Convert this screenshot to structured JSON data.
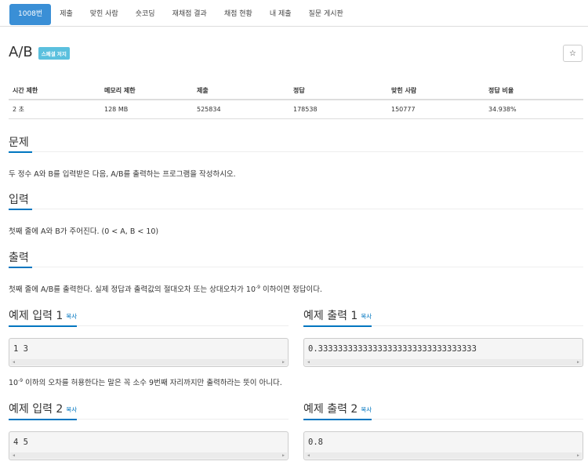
{
  "nav": {
    "items": [
      {
        "label": "1008번",
        "active": true
      },
      {
        "label": "제출"
      },
      {
        "label": "맞힌 사람"
      },
      {
        "label": "숏코딩"
      },
      {
        "label": "재채점 결과"
      },
      {
        "label": "채점 현황"
      },
      {
        "label": "내 제출"
      },
      {
        "label": "질문 게시판"
      }
    ]
  },
  "problem": {
    "title": "A/B",
    "badge": "스페셜 저지",
    "star_icon": "star-icon",
    "star_glyph": "☆"
  },
  "info": {
    "headers": [
      "시간 제한",
      "메모리 제한",
      "제출",
      "정답",
      "맞힌 사람",
      "정답 비율"
    ],
    "values": [
      "2 초",
      "128 MB",
      "525834",
      "178538",
      "150777",
      "34.938%"
    ]
  },
  "sections": {
    "problem_heading": "문제",
    "problem_text": "두 정수 A와 B를 입력받은 다음, A/B를 출력하는 프로그램을 작성하시오.",
    "input_heading": "입력",
    "input_text": "첫째 줄에 A와 B가 주어진다. (0 < A, B < 10)",
    "output_heading": "출력",
    "output_text_1": "첫째 줄에 A/B를 출력한다. 실제 정답과 출력값의 절대오차 또는 상대오차가 10",
    "output_sup": "-9",
    "output_text_2": " 이하이면 정답이다."
  },
  "examples": {
    "copy_label": "복사",
    "input1_heading": "예제 입력 1",
    "input1": "1 3",
    "output1_heading": "예제 출력 1",
    "output1": "0.33333333333333333333333333333333",
    "note_1": "10",
    "note_sup": "-9",
    "note_2": " 이하의 오차를 허용한다는 말은 꼭 소수 9번째 자리까지만 출력하라는 뜻이 아니다.",
    "input2_heading": "예제 입력 2",
    "input2": "4 5",
    "output2_heading": "예제 출력 2",
    "output2": "0.8"
  }
}
